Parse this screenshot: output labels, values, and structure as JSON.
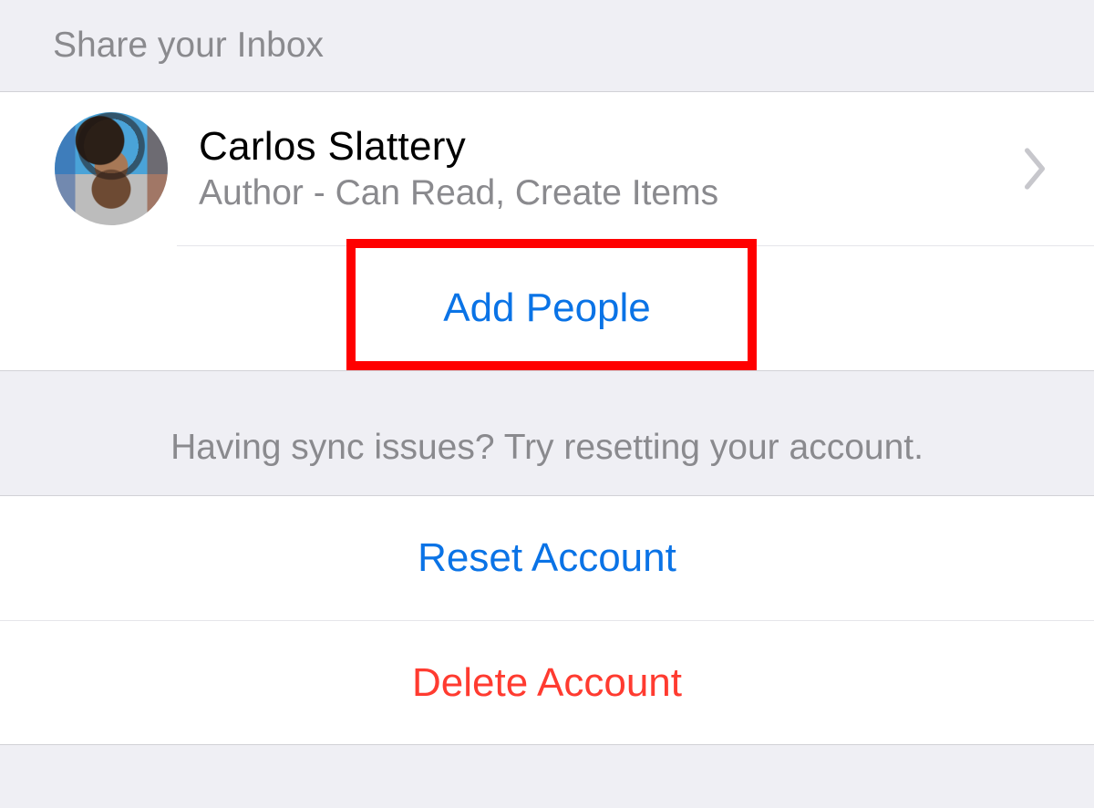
{
  "share_section": {
    "header": "Share your Inbox",
    "person": {
      "name": "Carlos Slattery",
      "role": "Author - Can Read, Create Items"
    },
    "add_people_label": "Add People"
  },
  "sync_section": {
    "header": "Having sync issues? Try resetting your account.",
    "reset_label": "Reset Account",
    "delete_label": "Delete Account"
  }
}
